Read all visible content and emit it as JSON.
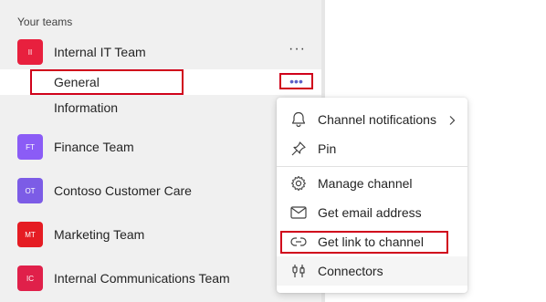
{
  "sidebar": {
    "section_title": "Your teams",
    "teams": [
      {
        "initials": "II",
        "name": "Internal IT Team",
        "color": "#e8203e",
        "more": "···"
      },
      {
        "initials": "FT",
        "name": "Finance Team",
        "color": "#8b5cf6"
      },
      {
        "initials": "OT",
        "name": "Contoso Customer Care",
        "color": "#7c5ce6"
      },
      {
        "initials": "MT",
        "name": "Marketing Team",
        "color": "#e51c23"
      },
      {
        "initials": "IC",
        "name": "Internal Communications Team",
        "color": "#e0204a"
      }
    ],
    "channels": [
      {
        "name": "General",
        "more": "•••"
      },
      {
        "name": "Information"
      }
    ]
  },
  "context_menu": {
    "items": [
      {
        "label": "Channel notifications",
        "icon": "bell-icon"
      },
      {
        "label": "Pin",
        "icon": "pin-icon"
      },
      {
        "label": "Manage channel",
        "icon": "gear-icon"
      },
      {
        "label": "Get email address",
        "icon": "mail-icon"
      },
      {
        "label": "Get link to channel",
        "icon": "link-icon"
      },
      {
        "label": "Connectors",
        "icon": "connector-icon"
      }
    ]
  },
  "colors": {
    "highlight": "#d0021b",
    "accent": "#5b5fc7"
  }
}
